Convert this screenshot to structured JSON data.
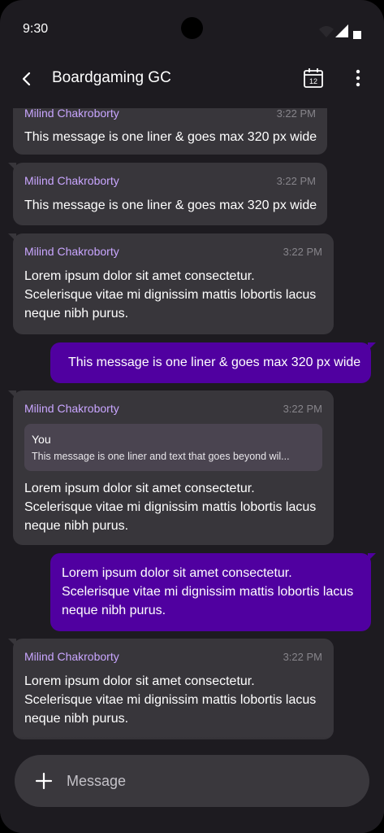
{
  "status_bar": {
    "time": "9:30"
  },
  "header": {
    "title": "Boardgaming GC"
  },
  "messages": [
    {
      "type": "incoming",
      "sender": "Milind Chakroborty",
      "time": "3:22 PM",
      "text": "This message is one liner & goes max 320 px wide"
    },
    {
      "type": "incoming",
      "sender": "Milind Chakroborty",
      "time": "3:22 PM",
      "text": "This message is one liner & goes max 320 px wide"
    },
    {
      "type": "incoming",
      "sender": "Milind Chakroborty",
      "time": "3:22 PM",
      "lines": [
        "Lorem ipsum dolor sit amet consectetur.",
        "Scelerisque vitae mi dignissim mattis lobortis lacus",
        "neque nibh purus."
      ]
    },
    {
      "type": "outgoing",
      "text": "This message is one liner & goes max 320 px wide"
    },
    {
      "type": "incoming",
      "sender": "Milind Chakroborty",
      "time": "3:22 PM",
      "quote": {
        "author": "You",
        "text": "This message is one liner and text that goes beyond wil..."
      },
      "lines": [
        "Lorem ipsum dolor sit amet consectetur.",
        "Scelerisque vitae mi dignissim mattis lobortis lacus",
        "neque nibh purus."
      ]
    },
    {
      "type": "outgoing",
      "lines": [
        "Lorem ipsum dolor sit amet consectetur.",
        "Scelerisque vitae mi dignissim mattis lobortis lacus",
        "neque nibh purus."
      ]
    },
    {
      "type": "incoming",
      "sender": "Milind Chakroborty",
      "time": "3:22 PM",
      "lines": [
        "Lorem ipsum dolor sit amet consectetur.",
        "Scelerisque vitae mi dignissim mattis lobortis lacus",
        "neque nibh purus."
      ]
    }
  ],
  "composer": {
    "placeholder": "Message"
  },
  "calendar_icon": {
    "day": "12"
  },
  "colors": {
    "incoming_bubble": "#38363b",
    "outgoing_bubble": "#5000a0",
    "sender_name": "#c9a6ff",
    "background": "#1d1b20"
  }
}
